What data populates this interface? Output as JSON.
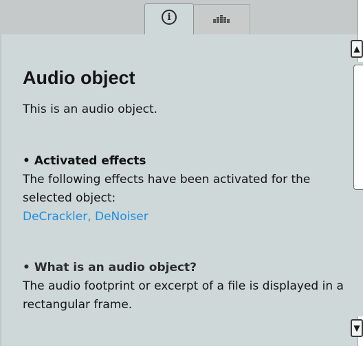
{
  "tabs": [
    {
      "name": "info",
      "icon": "info-icon",
      "glyph": "i",
      "active": true
    },
    {
      "name": "meter",
      "icon": "level-meter-icon",
      "active": false
    }
  ],
  "panel": {
    "title": "Audio object",
    "intro": "This is an audio object.",
    "sections": [
      {
        "heading": "Activated effects",
        "text": "The following effects have been activated for the selected object:",
        "links": "DeCrackler, DeNoiser"
      },
      {
        "heading": "What is an audio object?",
        "text": "The audio footprint or excerpt of a file is displayed in a rectangular frame."
      }
    ]
  },
  "scrollbar": {
    "up_icon": "triangle-up-icon",
    "down_icon": "triangle-down-icon",
    "up_glyph": "▲",
    "down_glyph": "▼"
  },
  "colors": {
    "panel_bg": "#cfd8d8",
    "tabstrip_bg": "#c6c9c9",
    "link": "#1d8fe0",
    "text": "#141414"
  }
}
